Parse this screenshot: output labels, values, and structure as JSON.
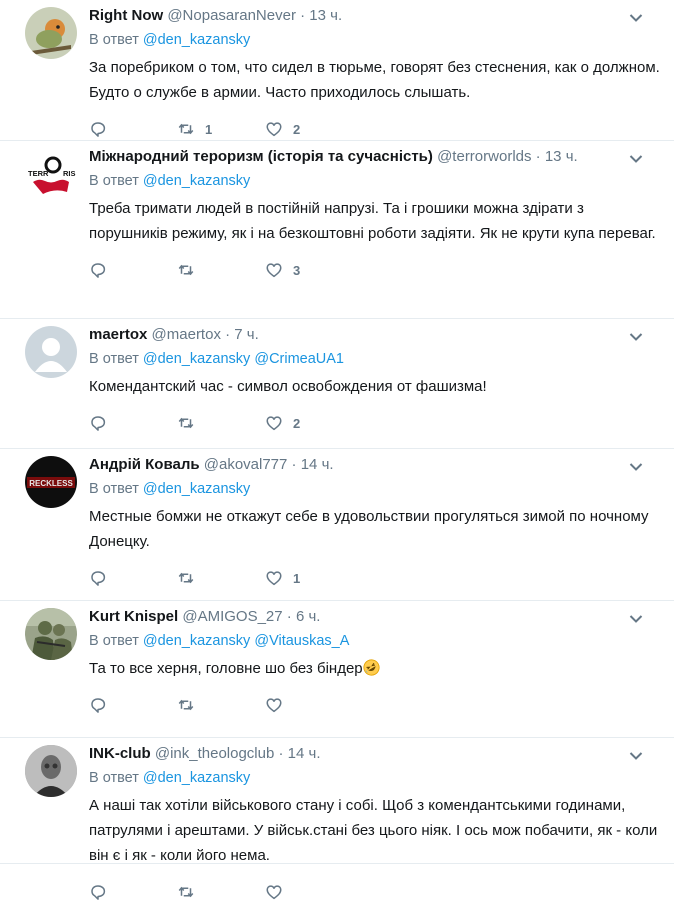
{
  "colors": {
    "accent": "#1b95e0",
    "muted": "#657786",
    "text": "#14171a",
    "divider": "#e6ecf0"
  },
  "reply_prefix": "В ответ",
  "tweets": [
    {
      "name": "Right Now",
      "handle": "@NopasaranNever",
      "time": "13 ч.",
      "reply_to": [
        "@den_kazansky"
      ],
      "text": "За поребриком о том, что сидел в тюрьме, говорят без стеснения, как о должном. Будто о службе в армии. Часто приходилось слышать.",
      "retweets": "1",
      "likes": "2",
      "avatar_icon": "bird-photo-icon"
    },
    {
      "name": "Міжнародний тероризм (історія та сучасність)",
      "handle": "@terrorworlds",
      "time": "13 ч.",
      "reply_to": [
        "@den_kazansky"
      ],
      "text": "Треба тримати людей в постійній напрузі. Та і грошики можна здірати з порушників режиму, як і на безкоштовні роботи задіяти. Як не крути купа переваг.",
      "retweets": "",
      "likes": "3",
      "avatar_icon": "terrorism-logo-icon",
      "avatar_text": "TERR RIS"
    },
    {
      "name": "maertox",
      "handle": "@maertox",
      "time": "7 ч.",
      "reply_to": [
        "@den_kazansky",
        "@CrimeaUA1"
      ],
      "text": "Комендантский час - символ освобождения от фашизма!",
      "retweets": "",
      "likes": "2",
      "avatar_icon": "default-avatar-icon"
    },
    {
      "name": "Андрій Коваль",
      "handle": "@akoval777",
      "time": "14 ч.",
      "reply_to": [
        "@den_kazansky"
      ],
      "text": "Местные бомжи не откажут себе в удовольствии прогуляться зимой по ночному Донецку.",
      "retweets": "",
      "likes": "1",
      "avatar_icon": "reckless-logo-icon",
      "avatar_text": "RECKLESS"
    },
    {
      "name": "Kurt Knispel",
      "handle": "@AMIGOS_27",
      "time": "6 ч.",
      "reply_to": [
        "@den_kazansky",
        "@Vitauskas_A"
      ],
      "text": "Та то все херня, головне шо без біндер",
      "retweets": "",
      "likes": "",
      "avatar_icon": "soldier-photo-icon",
      "emoji": "rofl-emoji-icon"
    },
    {
      "name": "INK-club",
      "handle": "@ink_theologclub",
      "time": "14 ч.",
      "reply_to": [
        "@den_kazansky"
      ],
      "text": "А наші так хотіли військового стану і собі. Щоб з комендантськими годинами, патрулями і арештами. У військ.стані без цього ніяк. І ось мож побачити, як - коли він є і як - коли його нема.",
      "retweets": "",
      "likes": "",
      "avatar_icon": "portrait-photo-icon"
    }
  ]
}
